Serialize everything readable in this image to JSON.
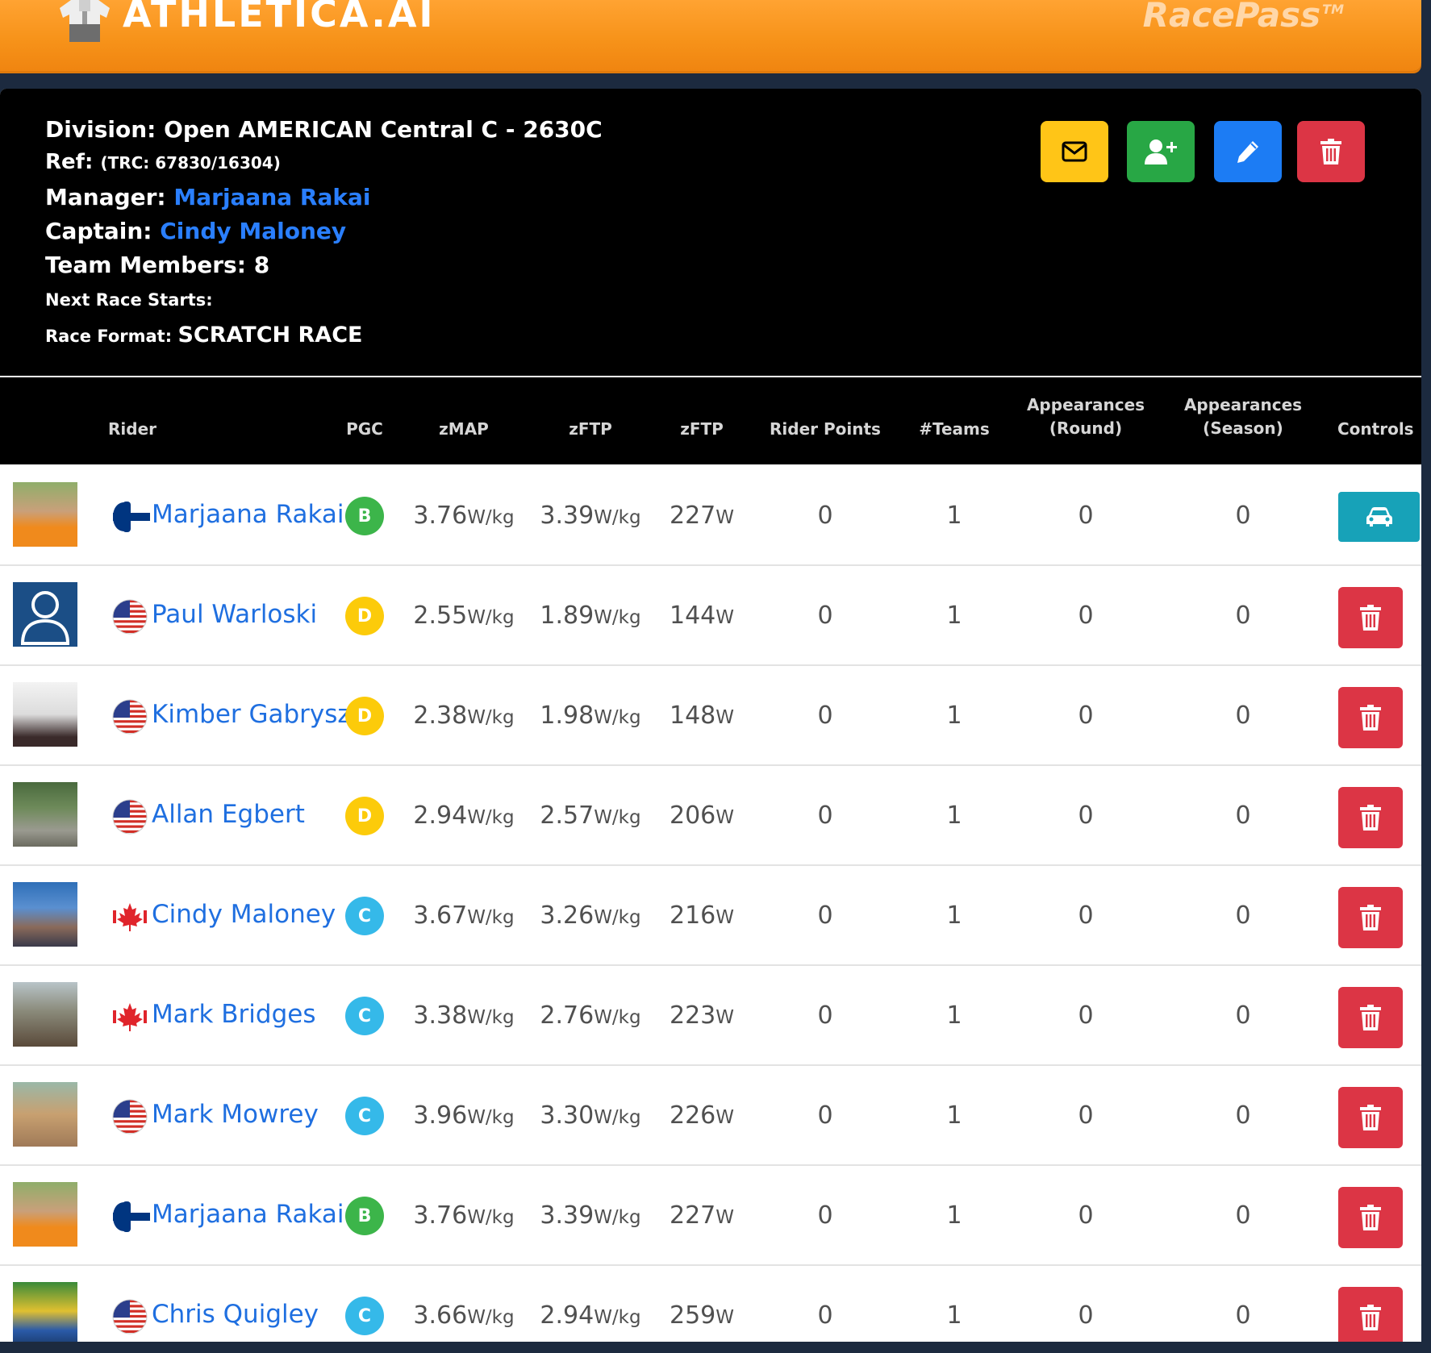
{
  "header": {
    "brand": "ATHLETICA.AI",
    "product": "RacePass",
    "product_mark": "TM"
  },
  "division": {
    "division_label": "Division:",
    "division_value": "Open AMERICAN Central C - 2630C",
    "ref_label": "Ref:",
    "ref_value": "(TRC: 67830/16304)",
    "manager_label": "Manager:",
    "manager_value": "Marjaana Rakai",
    "captain_label": "Captain:",
    "captain_value": "Cindy Maloney",
    "members_label": "Team Members:",
    "members_value": "8",
    "next_race_label": "Next Race Starts:",
    "format_label": "Race Format:",
    "format_value": "SCRATCH RACE"
  },
  "actions": {
    "mail_icon": "envelope-icon",
    "add_icon": "user-plus-icon",
    "edit_icon": "pencil-icon",
    "delete_icon": "trash-icon"
  },
  "colors": {
    "header_orange": "#f7931a",
    "link_blue": "#1f6fe0",
    "yellow": "#ffc517",
    "green": "#28a745",
    "blue": "#1c7cf4",
    "red": "#dc3545",
    "teal": "#17a2b8",
    "pgc_b": "#3cb54a",
    "pgc_c": "#35b9e9",
    "pgc_d": "#fccb0a"
  },
  "table": {
    "headers": {
      "rider": "Rider",
      "pgc": "PGC",
      "zmap": "zMAP",
      "zftp_wkg": "zFTP",
      "zftp_w": "zFTP",
      "rider_points": "Rider Points",
      "teams": "#Teams",
      "app_round_1": "Appearances",
      "app_round_2": "(Round)",
      "app_season_1": "Appearances",
      "app_season_2": "(Season)",
      "controls": "Controls"
    },
    "units": {
      "wkg": "W/kg",
      "w": "W"
    },
    "rows": [
      {
        "name": "Marjaana Rakai",
        "flag": "finland-flag",
        "pgc": "B",
        "zmap": "3.76",
        "zftp_wkg": "3.39",
        "zftp_w": "227",
        "points": "0",
        "teams": "1",
        "app_round": "0",
        "app_season": "0",
        "control": "car"
      },
      {
        "name": "Paul Warloski",
        "flag": "usa-flag",
        "pgc": "D",
        "zmap": "2.55",
        "zftp_wkg": "1.89",
        "zftp_w": "144",
        "points": "0",
        "teams": "1",
        "app_round": "0",
        "app_season": "0",
        "control": "delete"
      },
      {
        "name": "Kimber Gabryszak",
        "flag": "usa-flag",
        "pgc": "D",
        "zmap": "2.38",
        "zftp_wkg": "1.98",
        "zftp_w": "148",
        "points": "0",
        "teams": "1",
        "app_round": "0",
        "app_season": "0",
        "control": "delete"
      },
      {
        "name": "Allan Egbert",
        "flag": "usa-flag",
        "pgc": "D",
        "zmap": "2.94",
        "zftp_wkg": "2.57",
        "zftp_w": "206",
        "points": "0",
        "teams": "1",
        "app_round": "0",
        "app_season": "0",
        "control": "delete"
      },
      {
        "name": "Cindy Maloney",
        "flag": "canada-flag",
        "pgc": "C",
        "zmap": "3.67",
        "zftp_wkg": "3.26",
        "zftp_w": "216",
        "points": "0",
        "teams": "1",
        "app_round": "0",
        "app_season": "0",
        "control": "delete"
      },
      {
        "name": "Mark Bridges",
        "flag": "canada-flag",
        "pgc": "C",
        "zmap": "3.38",
        "zftp_wkg": "2.76",
        "zftp_w": "223",
        "points": "0",
        "teams": "1",
        "app_round": "0",
        "app_season": "0",
        "control": "delete"
      },
      {
        "name": "Mark Mowrey",
        "flag": "usa-flag",
        "pgc": "C",
        "zmap": "3.96",
        "zftp_wkg": "3.30",
        "zftp_w": "226",
        "points": "0",
        "teams": "1",
        "app_round": "0",
        "app_season": "0",
        "control": "delete"
      },
      {
        "name": "Marjaana Rakai",
        "flag": "finland-flag",
        "pgc": "B",
        "zmap": "3.76",
        "zftp_wkg": "3.39",
        "zftp_w": "227",
        "points": "0",
        "teams": "1",
        "app_round": "0",
        "app_season": "0",
        "control": "delete"
      },
      {
        "name": "Chris Quigley",
        "flag": "usa-flag",
        "pgc": "C",
        "zmap": "3.66",
        "zftp_wkg": "2.94",
        "zftp_w": "259",
        "points": "0",
        "teams": "1",
        "app_round": "0",
        "app_season": "0",
        "control": "delete"
      }
    ]
  }
}
